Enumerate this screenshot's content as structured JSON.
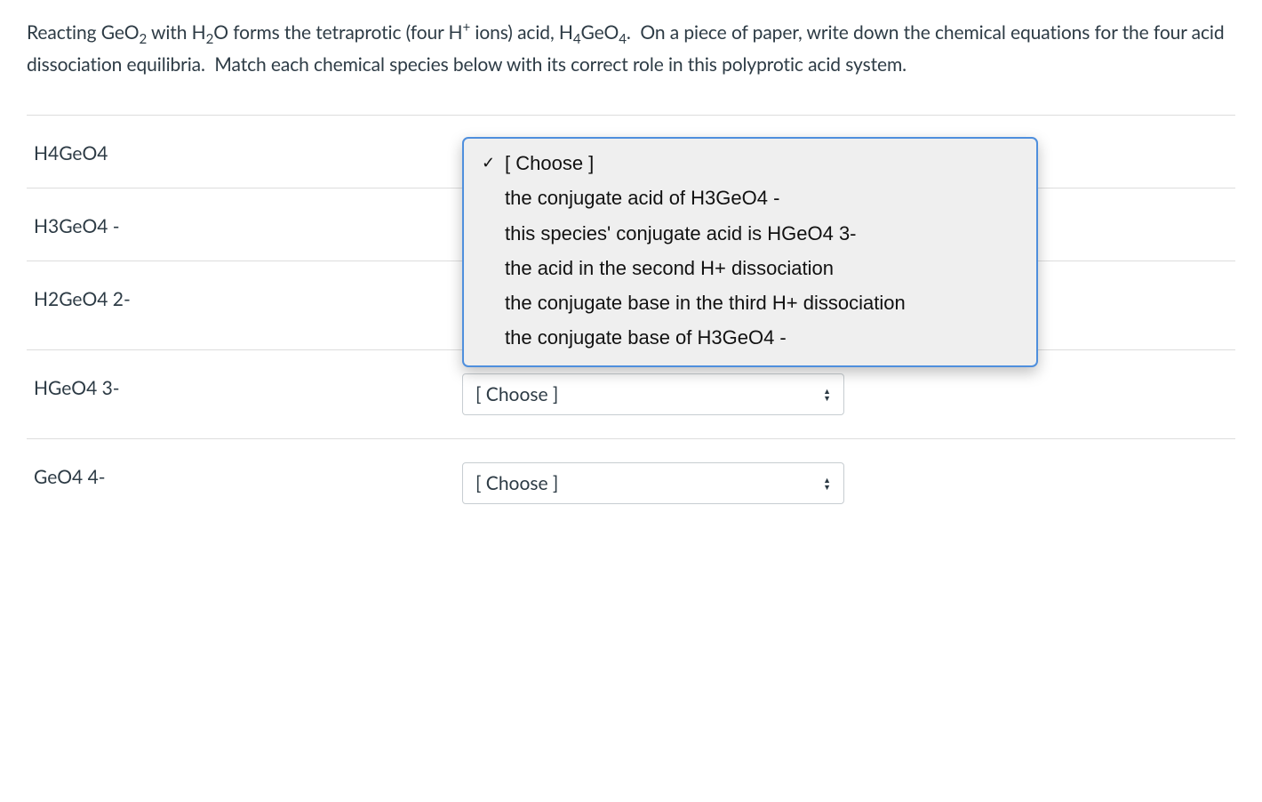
{
  "question": {
    "text_plain": "Reacting GeO2 with H2O forms the tetraprotic (four H+ ions) acid, H4GeO4.  On a piece of paper, write down the chemical equations for the four acid dissociation equilibria.  Match each chemical species below with its correct role in this polyprotic acid system."
  },
  "dropdown_placeholder": "[ Choose ]",
  "dropdown_options": [
    "[ Choose ]",
    "the conjugate acid of H3GeO4 -",
    "this species' conjugate acid is HGeO4 3-",
    "the acid in the second H+ dissociation",
    "the conjugate base in the third H+ dissociation",
    "the conjugate base of H3GeO4 -"
  ],
  "items": [
    {
      "label": "H4GeO4",
      "open": true
    },
    {
      "label": "H3GeO4 -",
      "open": false
    },
    {
      "label": "H2GeO4 2-",
      "open": false
    },
    {
      "label": "HGeO4 3-",
      "open": false
    },
    {
      "label": "GeO4 4-",
      "open": false
    }
  ]
}
